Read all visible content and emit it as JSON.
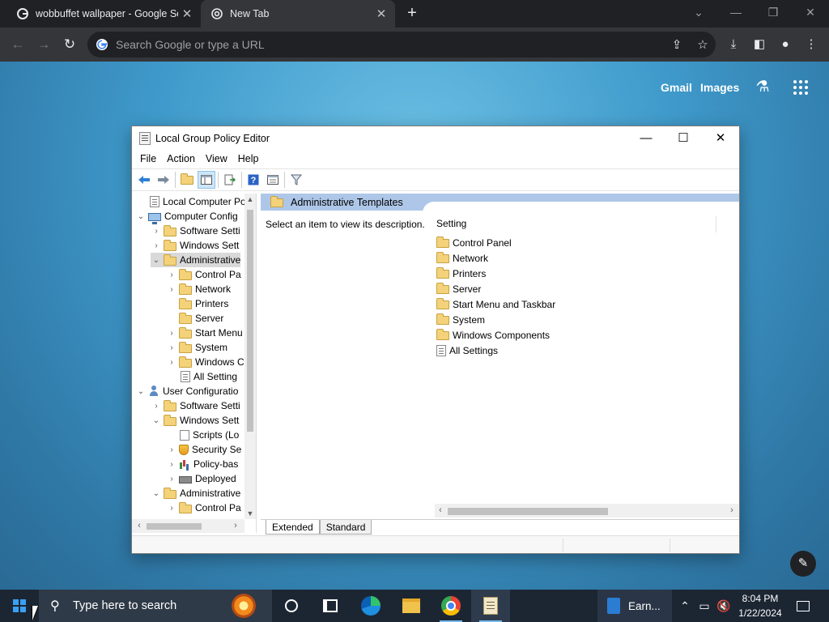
{
  "browser": {
    "tabs": [
      {
        "title": "wobbuffet wallpaper - Google Se",
        "favicon": "google-icon",
        "active": false
      },
      {
        "title": "New Tab",
        "favicon": "chrome-icon",
        "active": true
      }
    ],
    "omnibox_placeholder": "Search Google or type a URL",
    "ntp_links": {
      "gmail": "Gmail",
      "images": "Images"
    }
  },
  "gpedit": {
    "title": "Local Group Policy Editor",
    "menu": [
      "File",
      "Action",
      "Help",
      "View"
    ],
    "menu_order": [
      "File",
      "Action",
      "View",
      "Help"
    ],
    "tree": [
      {
        "label": "Local Computer Polic",
        "icon": "document-icon",
        "indent": 0,
        "toggle": ""
      },
      {
        "label": "Computer Config",
        "icon": "computer-icon",
        "indent": 0,
        "toggle": "open"
      },
      {
        "label": "Software Setti",
        "icon": "folder-icon",
        "indent": 1,
        "toggle": "closed"
      },
      {
        "label": "Windows Sett",
        "icon": "folder-icon",
        "indent": 1,
        "toggle": "closed"
      },
      {
        "label": "Administrative",
        "icon": "folder-icon",
        "indent": 1,
        "toggle": "open",
        "selected": true
      },
      {
        "label": "Control Pa",
        "icon": "folder-icon",
        "indent": 2,
        "toggle": "closed"
      },
      {
        "label": "Network",
        "icon": "folder-icon",
        "indent": 2,
        "toggle": "closed"
      },
      {
        "label": "Printers",
        "icon": "folder-icon",
        "indent": 2,
        "toggle": ""
      },
      {
        "label": "Server",
        "icon": "folder-icon",
        "indent": 2,
        "toggle": ""
      },
      {
        "label": "Start Menu",
        "icon": "folder-icon",
        "indent": 2,
        "toggle": "closed"
      },
      {
        "label": "System",
        "icon": "folder-icon",
        "indent": 2,
        "toggle": "closed"
      },
      {
        "label": "Windows C",
        "icon": "folder-icon",
        "indent": 2,
        "toggle": "closed"
      },
      {
        "label": "All Setting",
        "icon": "settings-list-icon",
        "indent": 2,
        "toggle": ""
      },
      {
        "label": "User Configuratio",
        "icon": "user-icon",
        "indent": 0,
        "toggle": "open"
      },
      {
        "label": "Software Setti",
        "icon": "folder-icon",
        "indent": 1,
        "toggle": "closed"
      },
      {
        "label": "Windows Sett",
        "icon": "folder-icon",
        "indent": 1,
        "toggle": "open"
      },
      {
        "label": "Scripts (Lo",
        "icon": "script-icon",
        "indent": 2,
        "toggle": ""
      },
      {
        "label": "Security Se",
        "icon": "security-icon",
        "indent": 2,
        "toggle": "closed"
      },
      {
        "label": "Policy-bas",
        "icon": "chart-icon",
        "indent": 2,
        "toggle": "closed"
      },
      {
        "label": "Deployed",
        "icon": "printer-icon",
        "indent": 2,
        "toggle": "closed"
      },
      {
        "label": "Administrative",
        "icon": "folder-icon",
        "indent": 1,
        "toggle": "open"
      },
      {
        "label": "Control Pa",
        "icon": "folder-icon",
        "indent": 2,
        "toggle": "closed"
      }
    ],
    "right_header": "Administrative Templates",
    "description": "Select an item to view its description.",
    "column_setting": "Setting",
    "items": [
      {
        "label": "Control Panel",
        "icon": "folder-icon"
      },
      {
        "label": "Network",
        "icon": "folder-icon"
      },
      {
        "label": "Printers",
        "icon": "folder-icon"
      },
      {
        "label": "Server",
        "icon": "folder-icon"
      },
      {
        "label": "Start Menu and Taskbar",
        "icon": "folder-icon"
      },
      {
        "label": "System",
        "icon": "folder-icon"
      },
      {
        "label": "Windows Components",
        "icon": "folder-icon"
      },
      {
        "label": "All Settings",
        "icon": "settings-list-icon"
      }
    ],
    "tabs": [
      {
        "label": "Extended",
        "active": true
      },
      {
        "label": "Standard",
        "active": false
      }
    ]
  },
  "taskbar": {
    "search_placeholder": "Type here to search",
    "earn_label": "Earn...",
    "time": "8:04 PM",
    "date": "1/22/2024"
  },
  "colors": {
    "chrome_dark": "#202124",
    "chrome_toolbar": "#35363a",
    "taskbar": "#1c2633",
    "gp_header": "#aec7e8"
  }
}
